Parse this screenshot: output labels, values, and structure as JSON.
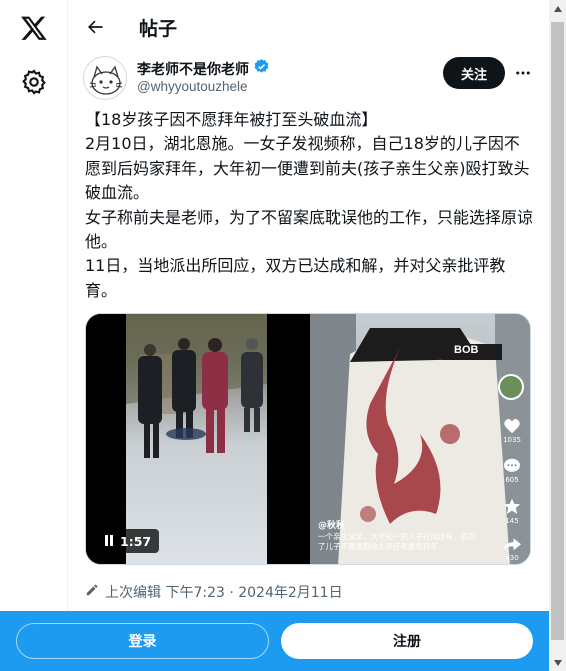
{
  "header": {
    "title": "帖子"
  },
  "author": {
    "name": "李老师不是你老师",
    "handle": "@whyyoutouzhele",
    "verified": true,
    "follow_label": "关注"
  },
  "tweet": {
    "text": "【18岁孩子因不愿拜年被打至头破血流】\n2月10日，湖北恩施。一女子发视频称，自己18岁的儿子因不愿到后妈家拜年，大年初一便遭到前夫(孩子亲生父亲)殴打致头破血流。\n女子称前夫是老师，为了不留案底耽误他的工作，只能选择原谅他。\n11日，当地派出所回应，双方已达成和解，并对父亲批评教育。"
  },
  "media": {
    "video_duration": "1:57",
    "right_overlay": {
      "username": "@秋秋",
      "caption": "一个亲生父亲，大年初一把儿子打成这样，就为了儿子不愿意跟他去现任老婆家拜年…",
      "jacket_brand": "BOB",
      "like_count": "1035",
      "comment_count": "605",
      "fav_count": "145",
      "share_count": "430"
    }
  },
  "meta": {
    "edited_label": "上次编辑 下午7:23 · 2024年2月11日"
  },
  "bottom_bar": {
    "login_label": "登录",
    "signup_label": "注册"
  },
  "colors": {
    "brand": "#1d9bf0",
    "text": "#0f1419",
    "secondary": "#536471",
    "border": "#eff3f4"
  }
}
